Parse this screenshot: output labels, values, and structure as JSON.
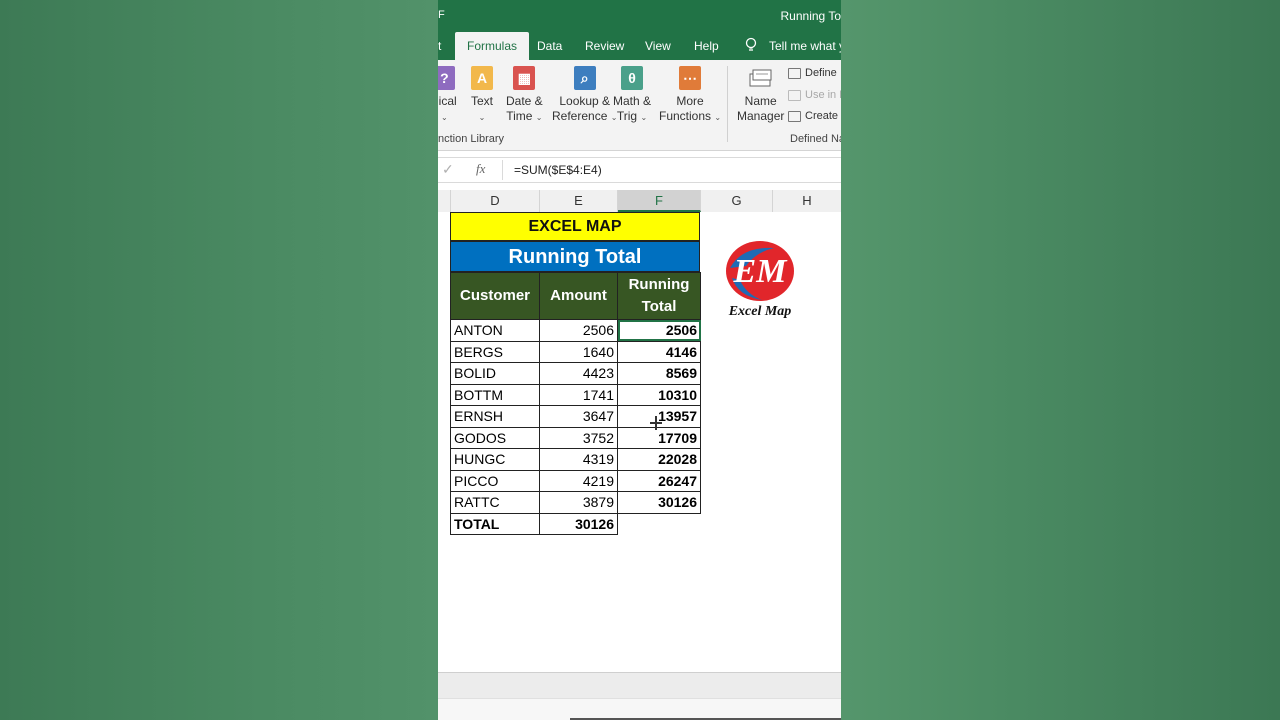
{
  "window": {
    "title": "Running To",
    "title_mark": "F"
  },
  "tabs": [
    {
      "label": "t",
      "active": false
    },
    {
      "label": "Formulas",
      "active": true
    },
    {
      "label": "Data",
      "active": false
    },
    {
      "label": "Review",
      "active": false
    },
    {
      "label": "View",
      "active": false
    },
    {
      "label": "Help",
      "active": false
    }
  ],
  "tell_me": "Tell me what y",
  "ribbon": {
    "buttons": [
      {
        "line1": "gical",
        "line2": "",
        "icon_color": "#8e6bbf",
        "icon_glyph": "?"
      },
      {
        "line1": "Text",
        "line2": "",
        "icon_color": "#f2b84b",
        "icon_glyph": "A"
      },
      {
        "line1": "Date &",
        "line2": "Time",
        "icon_color": "#d9534f",
        "icon_glyph": "▦"
      },
      {
        "line1": "Lookup &",
        "line2": "Reference",
        "icon_color": "#3d7ebf",
        "icon_glyph": "⌕"
      },
      {
        "line1": "Math &",
        "line2": "Trig",
        "icon_color": "#4aa08a",
        "icon_glyph": "θ"
      },
      {
        "line1": "More",
        "line2": "Functions",
        "icon_color": "#e07b39",
        "icon_glyph": "⋯"
      }
    ],
    "name_manager": {
      "line1": "Name",
      "line2": "Manager"
    },
    "function_library_label": "nction Library",
    "defined_names_label": "Defined Na",
    "defined_items": [
      {
        "label": "Define",
        "disabled": false
      },
      {
        "label": "Use in F",
        "disabled": true
      },
      {
        "label": "Create",
        "disabled": false
      }
    ]
  },
  "formula_bar": {
    "formula": "=SUM($E$4:E4)",
    "fx": "fx",
    "check": "✓"
  },
  "columns": [
    "D",
    "E",
    "F",
    "G",
    "H"
  ],
  "selected_column": "F",
  "sheet": {
    "title": "EXCEL MAP",
    "subtitle": "Running Total",
    "headers": {
      "customer": "Customer",
      "amount": "Amount",
      "running_total_1": "Running",
      "running_total_2": "Total"
    },
    "rows": [
      {
        "customer": "ANTON",
        "amount": "2506",
        "running_total": "2506"
      },
      {
        "customer": "BERGS",
        "amount": "1640",
        "running_total": "4146"
      },
      {
        "customer": "BOLID",
        "amount": "4423",
        "running_total": "8569"
      },
      {
        "customer": "BOTTM",
        "amount": "1741",
        "running_total": "10310"
      },
      {
        "customer": "ERNSH",
        "amount": "3647",
        "running_total": "13957"
      },
      {
        "customer": "GODOS",
        "amount": "3752",
        "running_total": "17709"
      },
      {
        "customer": "HUNGC",
        "amount": "4319",
        "running_total": "22028"
      },
      {
        "customer": "PICCO",
        "amount": "4219",
        "running_total": "26247"
      },
      {
        "customer": "RATTC",
        "amount": "3879",
        "running_total": "30126"
      }
    ],
    "total": {
      "label": "TOTAL",
      "amount": "30126"
    }
  },
  "logo": {
    "text": "Excel Map",
    "monogram": "EM"
  },
  "colors": {
    "excel_green": "#217346",
    "title_yellow": "#ffff00",
    "subtitle_blue": "#0070c0",
    "header_green": "#375623",
    "logo_red": "#e1262b",
    "logo_blue": "#1f6bb5"
  }
}
